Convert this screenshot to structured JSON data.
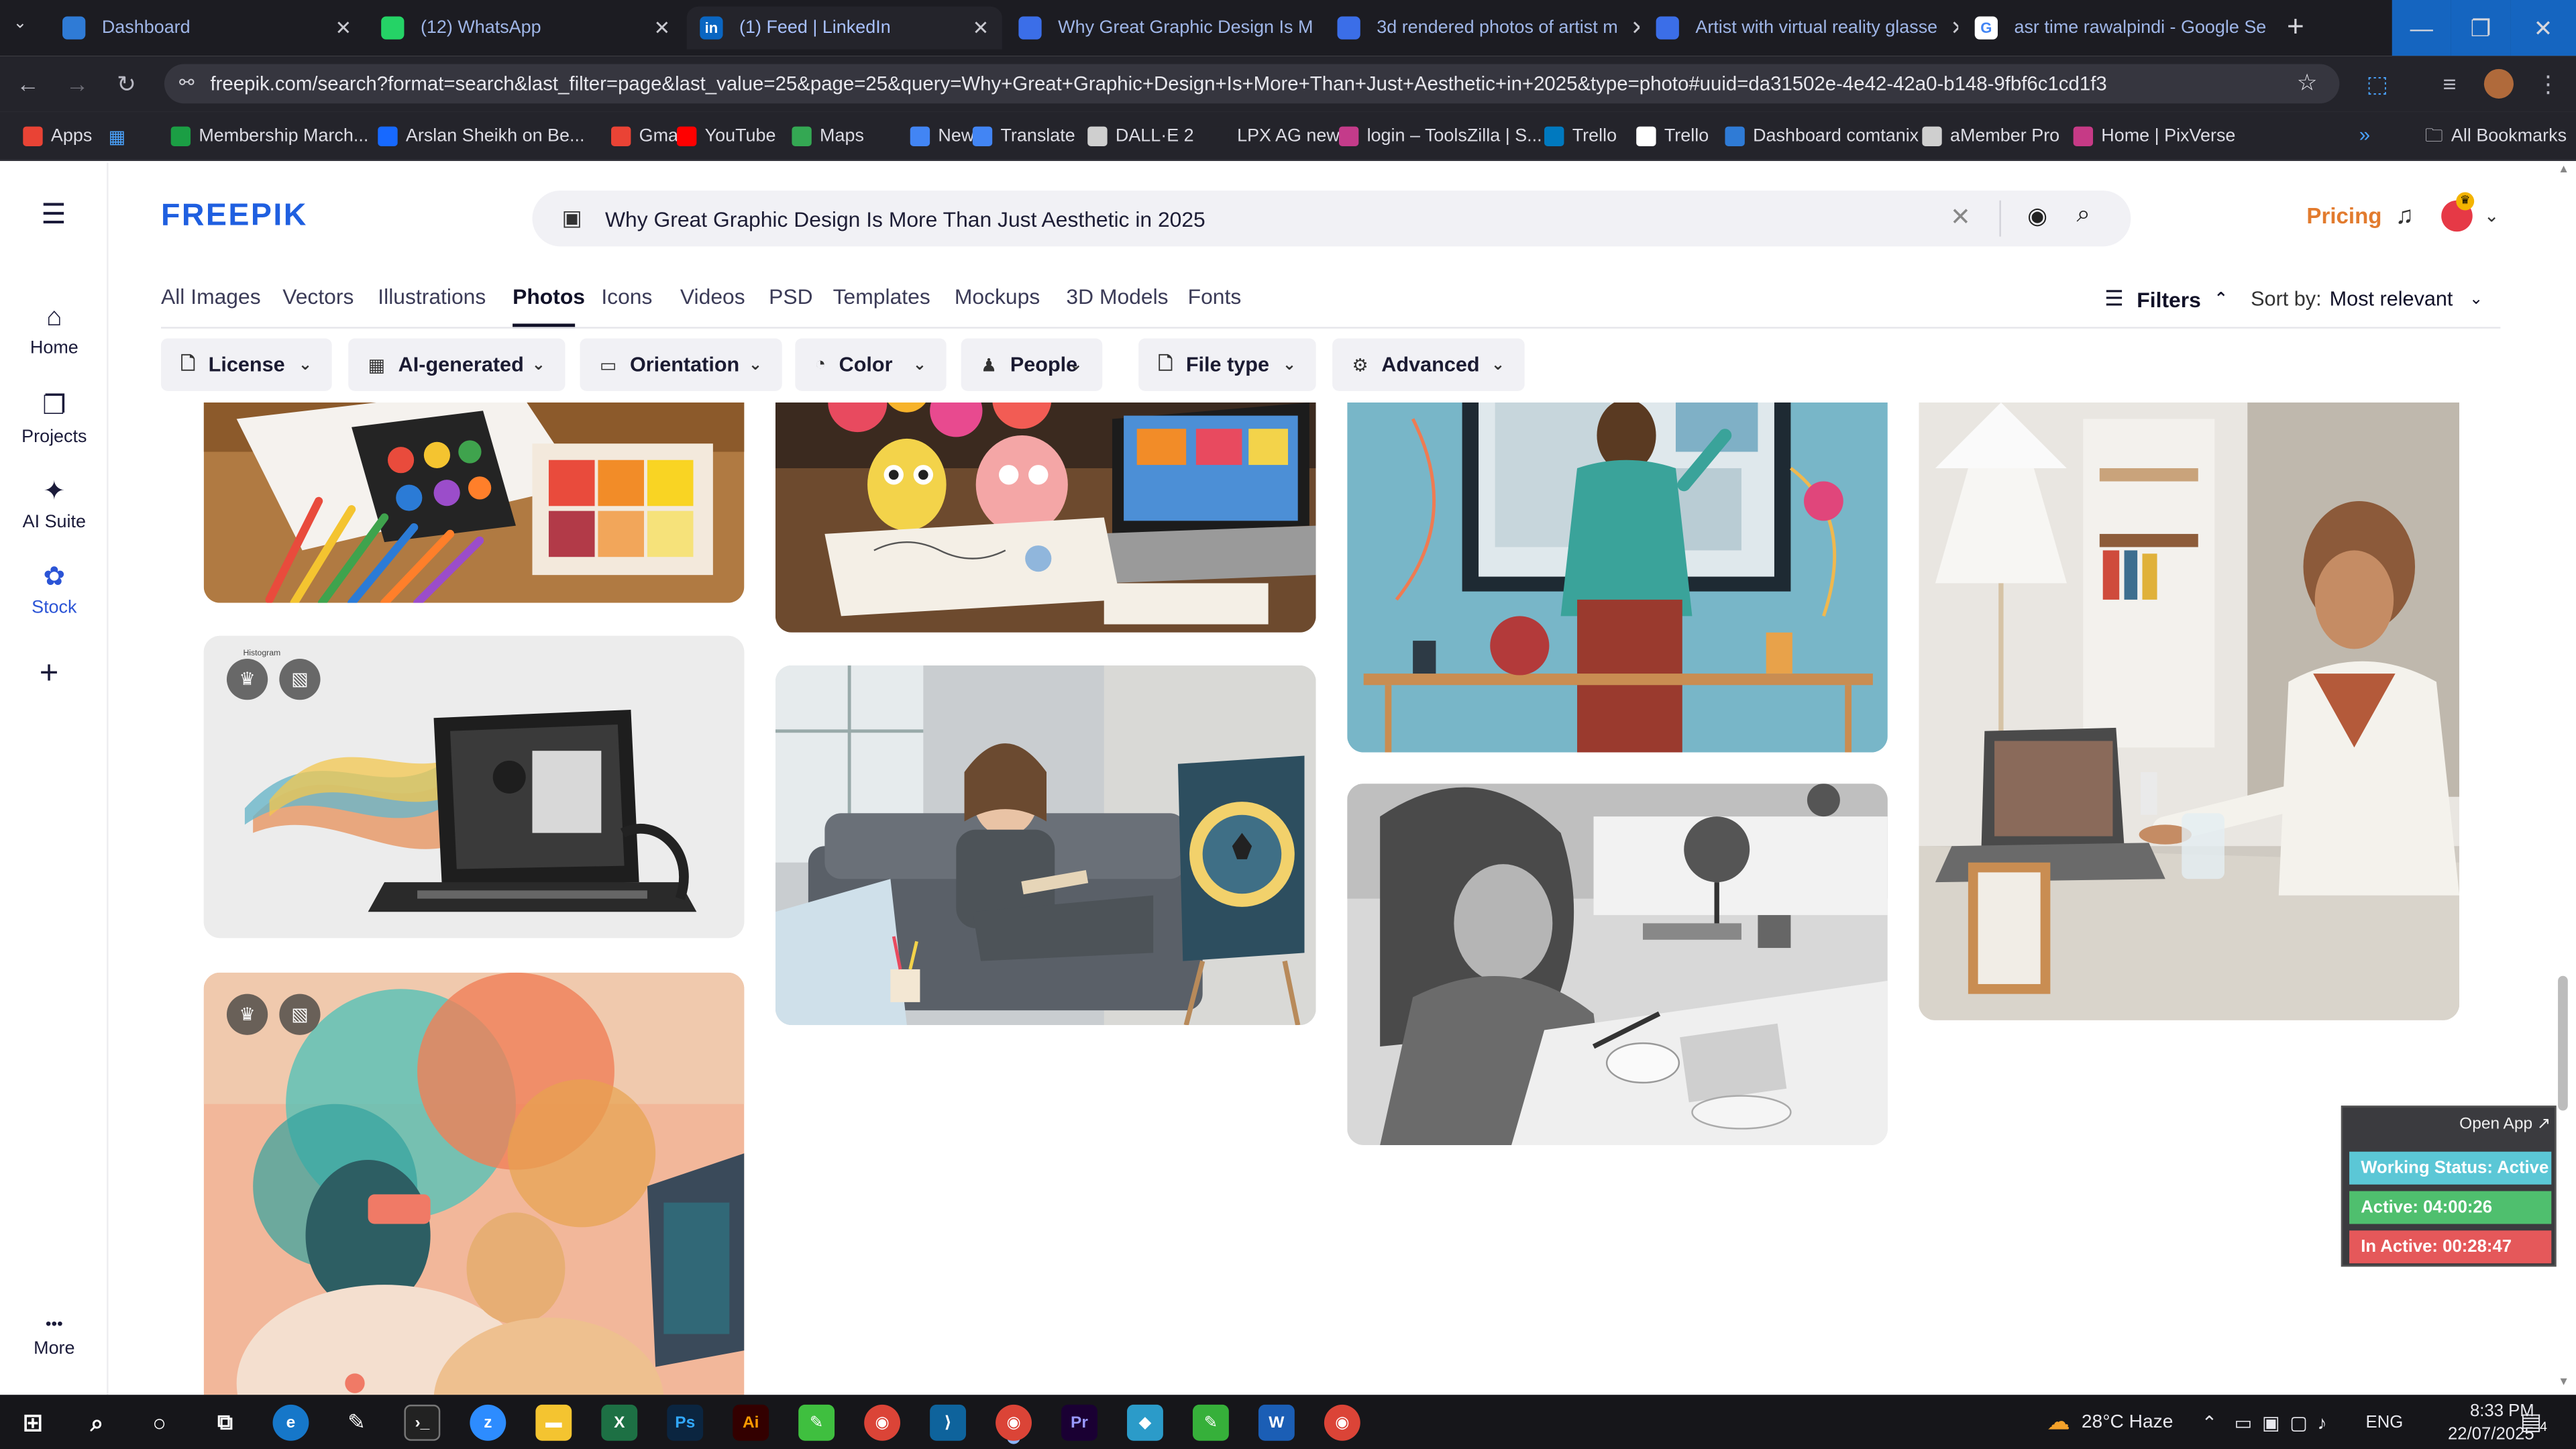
{
  "browser": {
    "tabs": [
      {
        "title": "Dashboard",
        "fav": "#2f7bd6",
        "favtext": "",
        "active": false
      },
      {
        "title": "(12) WhatsApp",
        "fav": "#25d366",
        "favtext": "",
        "active": false
      },
      {
        "title": "(1) Feed | LinkedIn",
        "fav": "#0a66c2",
        "favtext": "in",
        "active": true
      },
      {
        "title": "Why Great Graphic Design Is M",
        "fav": "#3b6ee8",
        "favtext": "",
        "active": false
      },
      {
        "title": "3d rendered photos of artist m",
        "fav": "#3b6ee8",
        "favtext": "",
        "active": false
      },
      {
        "title": "Artist with virtual reality glasse",
        "fav": "#3b6ee8",
        "favtext": "",
        "active": false
      },
      {
        "title": "asr time rawalpindi - Google Se",
        "fav": "#ffffff",
        "favtext": "G",
        "active": false
      }
    ],
    "new_tab": "+",
    "url": "freepik.com/search?format=search&last_filter=page&last_value=25&page=25&query=Why+Great+Graphic+Design+Is+More+Than+Just+Aesthetic+in+2025&type=photo#uuid=da31502e-4e42-42a0-b148-9fbf6c1cd1f3",
    "bookmarks": [
      {
        "label": "Apps",
        "color": "#e94335"
      },
      {
        "label": "Membership March...",
        "color": "#1b9e44"
      },
      {
        "label": "Arslan Sheikh on Be...",
        "color": "#1769ff"
      },
      {
        "label": "Gmail",
        "color": "#ea4335"
      },
      {
        "label": "YouTube",
        "color": "#ff0000"
      },
      {
        "label": "Maps",
        "color": "#34a853"
      },
      {
        "label": "News",
        "color": "#4285f4"
      },
      {
        "label": "Translate",
        "color": "#4285f4"
      },
      {
        "label": "DALL·E 2",
        "color": "#cfcfcf"
      },
      {
        "label": "LPX AG new",
        "color": "#24242b"
      },
      {
        "label": "login – ToolsZilla | S...",
        "color": "#c43b8a"
      },
      {
        "label": "Trello",
        "color": "#0079bf"
      },
      {
        "label": "Trello",
        "color": "#ffffff"
      },
      {
        "label": "Dashboard comtanix",
        "color": "#2f7bd6"
      },
      {
        "label": "aMember Pro",
        "color": "#cfcfcf"
      },
      {
        "label": "Home | PixVerse",
        "color": "#c63a86"
      }
    ],
    "all_bookmarks": "All Bookmarks"
  },
  "sidebar": {
    "items": [
      {
        "label": "Home",
        "icon": "⌂"
      },
      {
        "label": "Projects",
        "icon": "❐"
      },
      {
        "label": "AI Suite",
        "icon": "✦"
      },
      {
        "label": "Stock",
        "icon": "✿"
      }
    ],
    "add": "+",
    "more_dots": "•••",
    "more_label": "More"
  },
  "header": {
    "logo": "FREEPIK",
    "search_value": "Why Great Graphic Design Is More Than Just Aesthetic in 2025",
    "pricing": "Pricing"
  },
  "categories": [
    "All Images",
    "Vectors",
    "Illustrations",
    "Photos",
    "Icons",
    "Videos",
    "PSD",
    "Templates",
    "Mockups",
    "3D Models",
    "Fonts"
  ],
  "active_category": "Photos",
  "filters_label": "Filters",
  "sort_label": "Sort by:",
  "sort_value": "Most relevant",
  "chips": [
    {
      "label": "License",
      "icon": "🗋"
    },
    {
      "label": "AI-generated",
      "icon": "▦"
    },
    {
      "label": "Orientation",
      "icon": "▭"
    },
    {
      "label": "Color",
      "icon": "◔"
    },
    {
      "label": "People",
      "icon": "♟"
    },
    {
      "label": "File type",
      "icon": "🗋"
    },
    {
      "label": "Advanced",
      "icon": "⚙"
    }
  ],
  "image_caption_small": "Histogram",
  "tracker": {
    "open_app": "Open App ↗",
    "status": "Working Status: Active",
    "active": "Active: 04:00:26",
    "inactive": "In Active: 00:28:47",
    "status_color": "#5bc7d6",
    "active_color": "#4fbf6e",
    "inactive_color": "#e5585a"
  },
  "taskbar": {
    "weather": "28°C  Haze",
    "lang": "ENG",
    "time": "8:33 PM",
    "date": "22/07/2025",
    "notif_count": "4"
  }
}
